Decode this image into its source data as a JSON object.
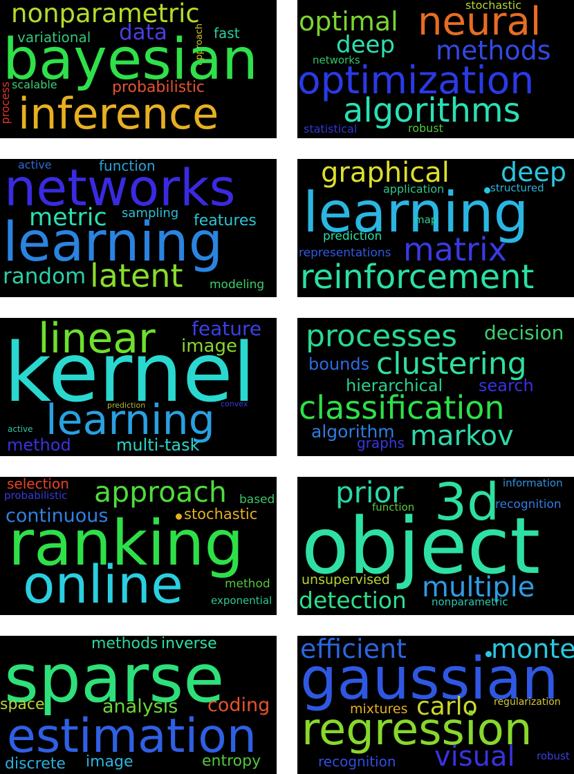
{
  "clouds": [
    {
      "words": [
        {
          "text": "nonparametric",
          "color": "#b4dc2c"
        },
        {
          "text": "data",
          "color": "#4a3ee0"
        },
        {
          "text": "fast",
          "color": "#2bd0a4"
        },
        {
          "text": "variational",
          "color": "#31c67b"
        },
        {
          "text": "approach",
          "color": "#d6c532"
        },
        {
          "text": "bayesian",
          "color": "#2fe04a"
        },
        {
          "text": "scalable",
          "color": "#3bd07a"
        },
        {
          "text": "probabilistic",
          "color": "#e8532d"
        },
        {
          "text": "process",
          "color": "#e0362a"
        },
        {
          "text": "inference",
          "color": "#e6b022"
        }
      ]
    },
    {
      "words": [
        {
          "text": "stochastic",
          "color": "#b7d238"
        },
        {
          "text": "optimal",
          "color": "#7bd62e"
        },
        {
          "text": "neural",
          "color": "#e86c24"
        },
        {
          "text": "deep",
          "color": "#2ee0b0"
        },
        {
          "text": "methods",
          "color": "#3448e4"
        },
        {
          "text": "networks",
          "color": "#2ec868"
        },
        {
          "text": "optimization",
          "color": "#2a3ae6"
        },
        {
          "text": "algorithms",
          "color": "#2be0b4"
        },
        {
          "text": "statistical",
          "color": "#3436d0"
        },
        {
          "text": "robust",
          "color": "#52c83c"
        }
      ]
    },
    {
      "words": [
        {
          "text": "active",
          "color": "#2f6ad6"
        },
        {
          "text": "function",
          "color": "#2aa3de"
        },
        {
          "text": "networks",
          "color": "#3a2ae0"
        },
        {
          "text": "metric",
          "color": "#2be0b0"
        },
        {
          "text": "sampling",
          "color": "#2cc0d8"
        },
        {
          "text": "features",
          "color": "#2cc6d4"
        },
        {
          "text": "learning",
          "color": "#2a84e0"
        },
        {
          "text": "random",
          "color": "#2ad0a8"
        },
        {
          "text": "latent",
          "color": "#88de2c"
        },
        {
          "text": "modeling",
          "color": "#3ad068"
        }
      ]
    },
    {
      "words": [
        {
          "text": "graphical",
          "color": "#dce02c"
        },
        {
          "text": "deep",
          "color": "#2cc6e0"
        },
        {
          "text": "application",
          "color": "#2fc88c"
        },
        {
          "text": "structured",
          "color": "#2fb3d8"
        },
        {
          "text": "learning",
          "color": "#2ab6e2"
        },
        {
          "text": "map",
          "color": "#2fd09a"
        },
        {
          "text": "prediction",
          "color": "#2ee0a8"
        },
        {
          "text": "matrix",
          "color": "#3a3ae4"
        },
        {
          "text": "representations",
          "color": "#2f5ae0"
        },
        {
          "text": "reinforcement",
          "color": "#2be0a4"
        }
      ]
    },
    {
      "words": [
        {
          "text": "linear",
          "color": "#6ee02c"
        },
        {
          "text": "feature",
          "color": "#3a40e4"
        },
        {
          "text": "image",
          "color": "#8ad62e"
        },
        {
          "text": "kernel",
          "color": "#2ad8d0"
        },
        {
          "text": "prediction",
          "color": "#b6b838"
        },
        {
          "text": "convex",
          "color": "#3a3ae4"
        },
        {
          "text": "learning",
          "color": "#2aa0e0"
        },
        {
          "text": "active",
          "color": "#2ec8a8"
        },
        {
          "text": "method",
          "color": "#3a32e0"
        },
        {
          "text": "multi-task",
          "color": "#2ad6c8"
        }
      ]
    },
    {
      "words": [
        {
          "text": "processes",
          "color": "#2ad890"
        },
        {
          "text": "decision",
          "color": "#3ed06c"
        },
        {
          "text": "bounds",
          "color": "#2f6ae2"
        },
        {
          "text": "clustering",
          "color": "#2fe09c"
        },
        {
          "text": "hierarchical",
          "color": "#2ad08c"
        },
        {
          "text": "search",
          "color": "#3a32e0"
        },
        {
          "text": "classification",
          "color": "#2ee048"
        },
        {
          "text": "algorithm",
          "color": "#2f7ce2"
        },
        {
          "text": "markov",
          "color": "#2ed8a8"
        },
        {
          "text": "graphs",
          "color": "#3a38e0"
        }
      ]
    },
    {
      "words": [
        {
          "text": "selection",
          "color": "#e8432a"
        },
        {
          "text": "probabilistic",
          "color": "#3a3ad8"
        },
        {
          "text": "approach",
          "color": "#4edc3c"
        },
        {
          "text": "based",
          "color": "#3ac86a"
        },
        {
          "text": "continuous",
          "color": "#2f82e2"
        },
        {
          "text": "stochastic",
          "color": "#e6b024"
        },
        {
          "text": "ranking",
          "color": "#2ee048"
        },
        {
          "text": "online",
          "color": "#2acfe0"
        },
        {
          "text": "method",
          "color": "#52c63c"
        },
        {
          "text": "exponential",
          "color": "#2ec898"
        }
      ]
    },
    {
      "words": [
        {
          "text": "prior",
          "color": "#2ad8a8"
        },
        {
          "text": "3d",
          "color": "#2ee0a0"
        },
        {
          "text": "information",
          "color": "#2f92e0"
        },
        {
          "text": "function",
          "color": "#62c83a"
        },
        {
          "text": "recognition",
          "color": "#2f7ee2"
        },
        {
          "text": "object",
          "color": "#2fe0a4"
        },
        {
          "text": "unsupervised",
          "color": "#b8d230"
        },
        {
          "text": "multiple",
          "color": "#2f9ce2"
        },
        {
          "text": "detection",
          "color": "#2ee08c"
        },
        {
          "text": "nonparametric",
          "color": "#2fc8b0"
        }
      ]
    },
    {
      "words": [
        {
          "text": "methods",
          "color": "#2ad8a0"
        },
        {
          "text": "inverse",
          "color": "#2ee0a8"
        },
        {
          "text": "sparse",
          "color": "#2ee07a"
        },
        {
          "text": "space",
          "color": "#b8d830"
        },
        {
          "text": "analysis",
          "color": "#6ad83a"
        },
        {
          "text": "coding",
          "color": "#e8532d"
        },
        {
          "text": "estimation",
          "color": "#2f60e4"
        },
        {
          "text": "discrete",
          "color": "#2ab0e0"
        },
        {
          "text": "image",
          "color": "#2cb6e2"
        },
        {
          "text": "entropy",
          "color": "#52c83c"
        }
      ]
    },
    {
      "words": [
        {
          "text": "efficient",
          "color": "#2a66e0"
        },
        {
          "text": "monte",
          "color": "#2ac8e0"
        },
        {
          "text": "gaussian",
          "color": "#2f58e2"
        },
        {
          "text": "mixtures",
          "color": "#e6b024"
        },
        {
          "text": "carlo",
          "color": "#c8d82e"
        },
        {
          "text": "regularization",
          "color": "#d8c838"
        },
        {
          "text": "regression",
          "color": "#88d82c"
        },
        {
          "text": "recognition",
          "color": "#2f4ee2"
        },
        {
          "text": "visual",
          "color": "#3a32e0"
        },
        {
          "text": "robust",
          "color": "#3a40e0"
        }
      ]
    }
  ],
  "dots": [
    {
      "color": "#2ac6e0"
    },
    {
      "color": "#e6b024"
    },
    {
      "color": "#2ac8e0"
    }
  ]
}
